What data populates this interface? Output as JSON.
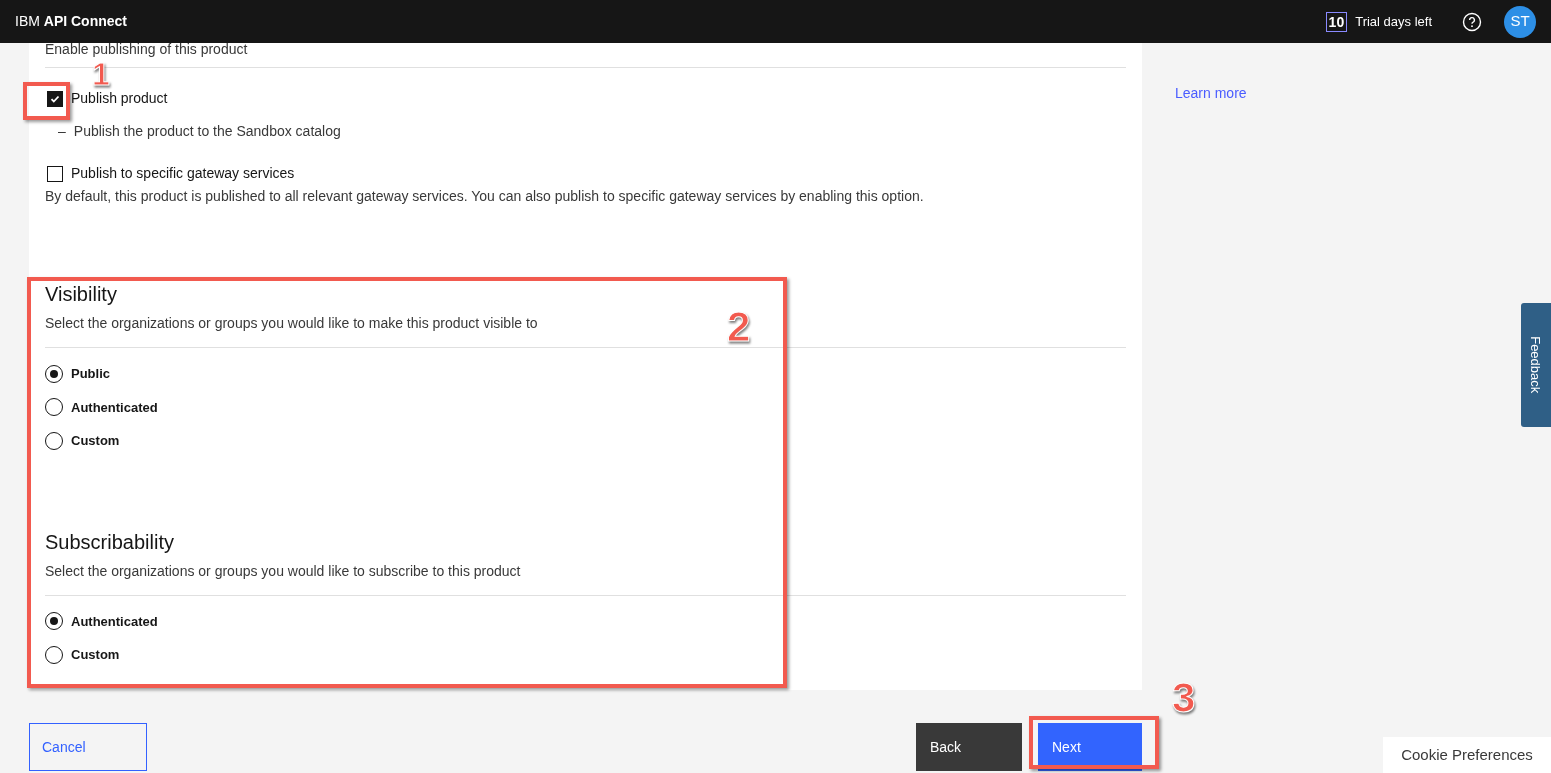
{
  "header": {
    "brand_prefix": "IBM",
    "brand": "API Connect",
    "trial_count": "10",
    "trial_label": "Trial days left",
    "avatar": "ST"
  },
  "publish": {
    "description": "Enable publishing of this product",
    "options": [
      {
        "label": "Publish product",
        "checked": true,
        "detail_marker": "–",
        "detail": "Publish the product to the Sandbox catalog"
      },
      {
        "label": "Publish to specific gateway services",
        "checked": false,
        "detail": "By default, this product is published to all relevant gateway services. You can also publish to specific gateway services by enabling this option."
      }
    ]
  },
  "sections": [
    {
      "title": "Visibility",
      "subtitle": "Select the organizations or groups you would like to make this product visible to",
      "options": [
        {
          "label": "Public",
          "selected": true
        },
        {
          "label": "Authenticated",
          "selected": false
        },
        {
          "label": "Custom",
          "selected": false
        }
      ]
    },
    {
      "title": "Subscribability",
      "subtitle": "Select the organizations or groups you would like to subscribe to this product",
      "options": [
        {
          "label": "Authenticated",
          "selected": true
        },
        {
          "label": "Custom",
          "selected": false
        }
      ]
    }
  ],
  "side_panel": {
    "link": "Learn more"
  },
  "feedback": "Feedback",
  "buttons": {
    "cancel": "Cancel",
    "back": "Back",
    "next": "Next"
  },
  "cookie": "Cookie Preferences",
  "annotations": [
    {
      "label": "1"
    },
    {
      "label": "2"
    },
    {
      "label": "3"
    }
  ]
}
